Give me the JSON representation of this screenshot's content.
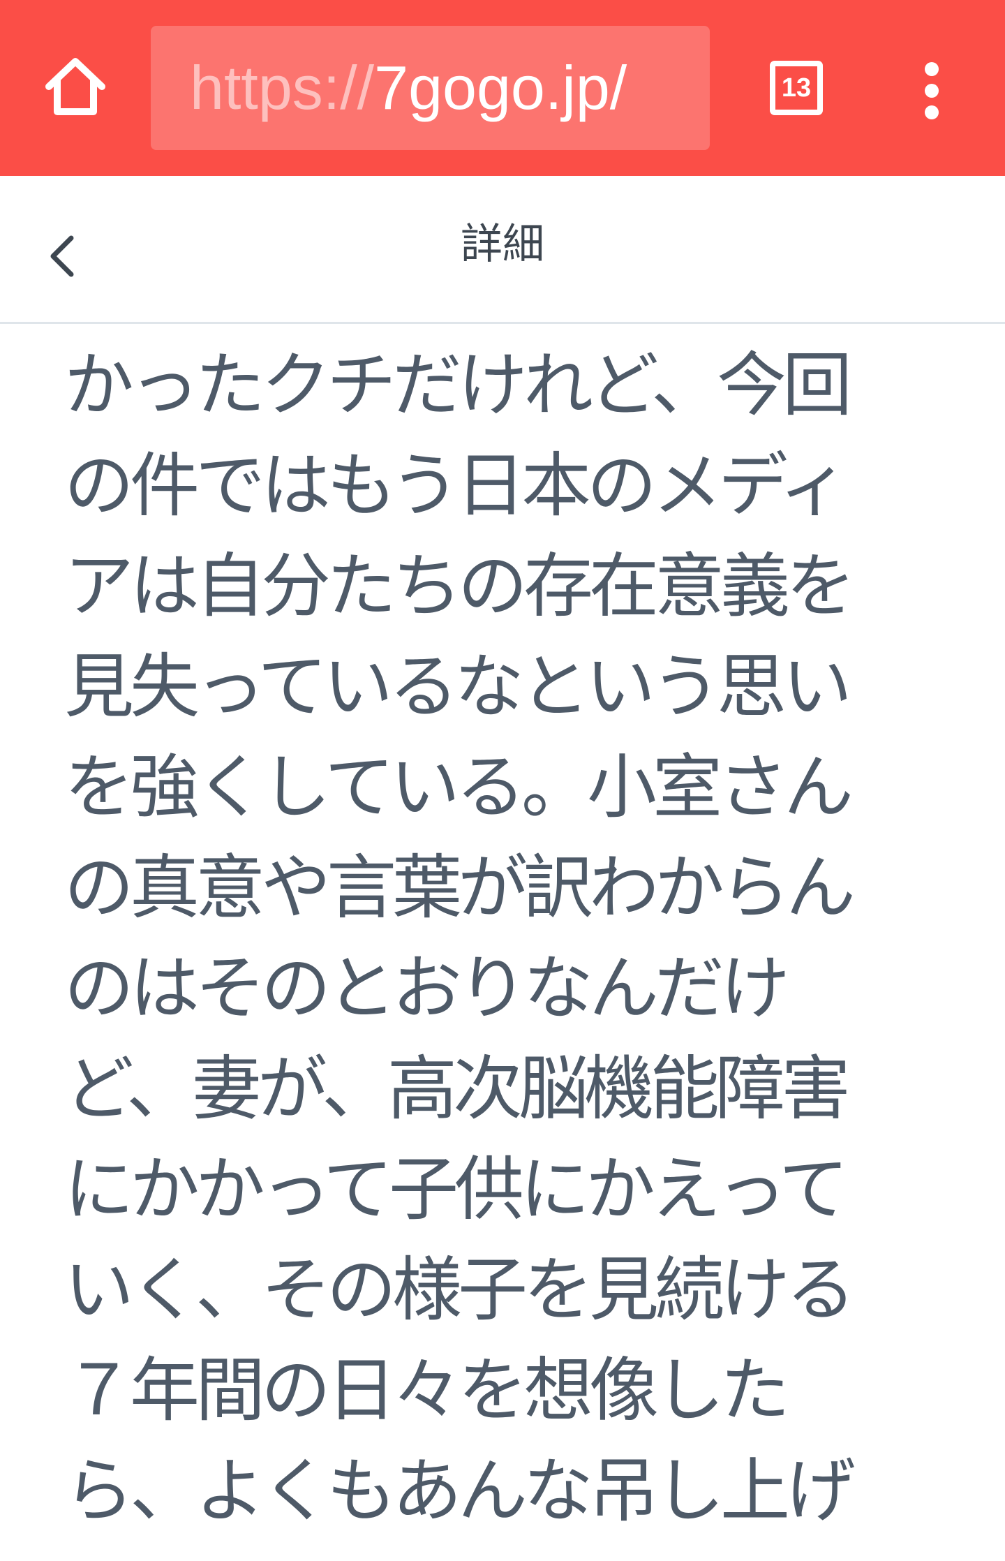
{
  "browser": {
    "url_scheme": "https://",
    "url_host": "7gogo.jp/",
    "tab_count": "13",
    "toolbar_color": "#fb4e47",
    "home_icon": "home-icon",
    "menu_icon": "more-vert-icon"
  },
  "header": {
    "title": "詳細",
    "back_icon": "chevron-left-icon"
  },
  "content": {
    "lines": [
      "かったクチだけれど、今回",
      "の件ではもう日本のメディ",
      "アは自分たちの存在意義を",
      "見失っているなという思い",
      "を強くしている。小室さん",
      "の真意や言葉が訳わからん",
      "のはそのとおりなんだけ",
      "ど、妻が、高次脳機能障害",
      "にかかって子供にかえって",
      "いく、その様子を見続ける",
      "７年間の日々を想像した",
      "ら、よくもあんな吊し上げ"
    ]
  }
}
